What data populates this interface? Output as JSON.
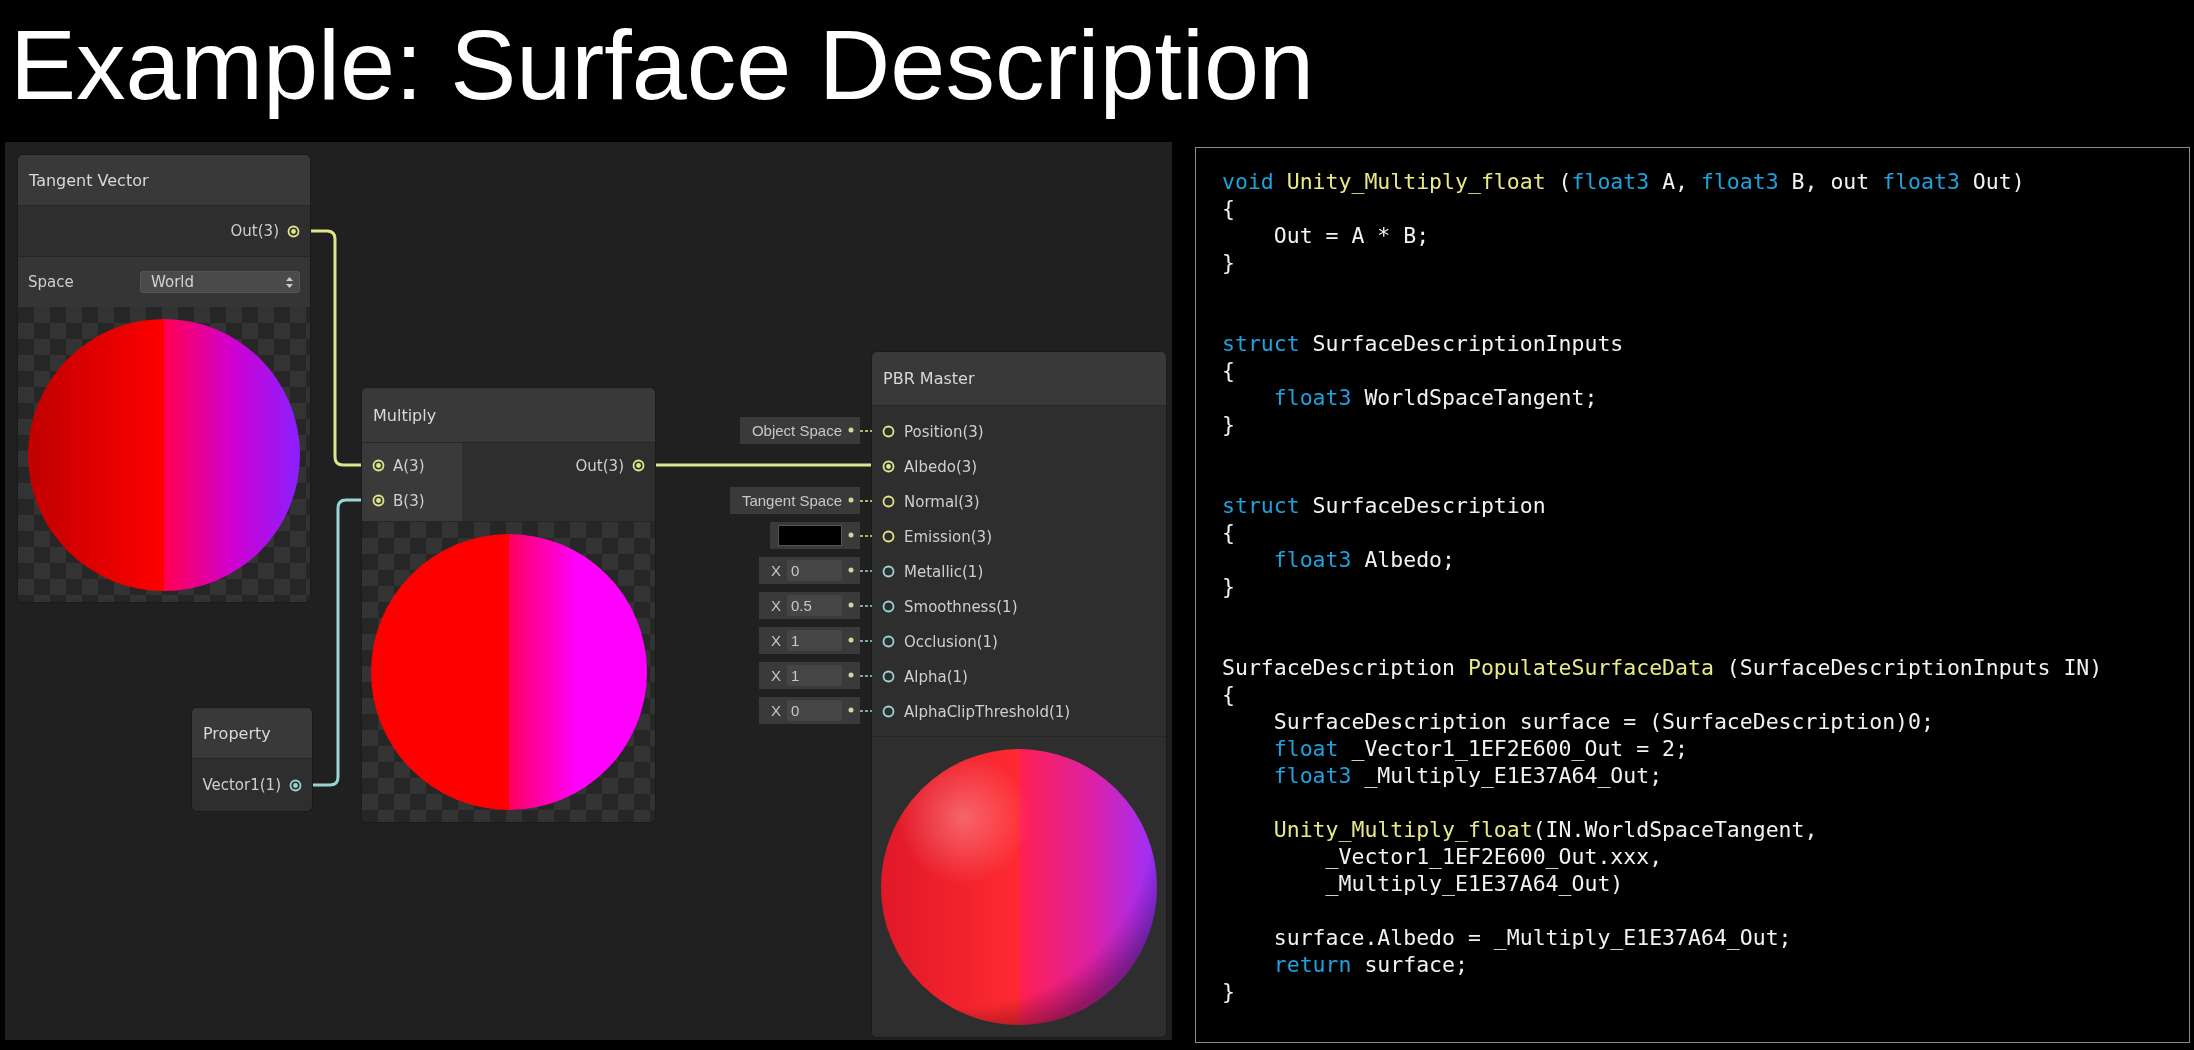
{
  "slide_title": "Example: Surface Description",
  "nodes": [
    {
      "kind": "tangent_vector",
      "title": "Tangent Vector",
      "outputs": [
        {
          "label": "Out(3)",
          "kind": "vector3",
          "connected": true
        }
      ],
      "controls": [
        {
          "label": "Space",
          "value": "World"
        }
      ]
    },
    {
      "kind": "multiply",
      "title": "Multiply",
      "inputs": [
        {
          "label": "A(3)",
          "kind": "vector3",
          "connected": true
        },
        {
          "label": "B(3)",
          "kind": "vector3",
          "connected": true
        }
      ],
      "outputs": [
        {
          "label": "Out(3)",
          "kind": "vector3",
          "connected": true
        }
      ]
    },
    {
      "kind": "property",
      "title": "Property",
      "outputs": [
        {
          "label": "Vector1(1)",
          "kind": "vector1",
          "connected": true
        }
      ]
    },
    {
      "kind": "master",
      "title": "PBR Master",
      "inputs": [
        {
          "label": "Position(3)",
          "kind": "vector3",
          "connected": false,
          "default": {
            "kind": "text",
            "text": "Object Space"
          }
        },
        {
          "label": "Albedo(3)",
          "kind": "vector3",
          "connected": true
        },
        {
          "label": "Normal(3)",
          "kind": "vector3",
          "connected": false,
          "default": {
            "kind": "text",
            "text": "Tangent Space"
          }
        },
        {
          "label": "Emission(3)",
          "kind": "vector3",
          "connected": false,
          "default": {
            "kind": "swatch",
            "color": "#000000"
          }
        },
        {
          "label": "Metallic(1)",
          "kind": "vector1",
          "connected": false,
          "default": {
            "kind": "number",
            "axis": "X",
            "value": "0"
          }
        },
        {
          "label": "Smoothness(1)",
          "kind": "vector1",
          "connected": false,
          "default": {
            "kind": "number",
            "axis": "X",
            "value": "0.5"
          }
        },
        {
          "label": "Occlusion(1)",
          "kind": "vector1",
          "connected": false,
          "default": {
            "kind": "number",
            "axis": "X",
            "value": "1"
          }
        },
        {
          "label": "Alpha(1)",
          "kind": "vector1",
          "connected": false,
          "default": {
            "kind": "number",
            "axis": "X",
            "value": "1"
          }
        },
        {
          "label": "AlphaClipThreshold(1)",
          "kind": "vector1",
          "connected": false,
          "default": {
            "kind": "number",
            "axis": "X",
            "value": "0"
          }
        }
      ]
    }
  ],
  "code": [
    {
      "kind": "section",
      "lines": [
        [
          {
            "text": "void ",
            "kind": "keyword"
          },
          {
            "text": "Unity_Multiply_float",
            "kind": "function"
          },
          {
            "text": " (",
            "kind": "plain"
          },
          {
            "text": "float3",
            "kind": "keyword"
          },
          {
            "text": " A, ",
            "kind": "plain"
          },
          {
            "text": "float3",
            "kind": "keyword"
          },
          {
            "text": " B, out ",
            "kind": "plain"
          },
          {
            "text": "float3",
            "kind": "keyword"
          },
          {
            "text": " Out)",
            "kind": "plain"
          }
        ],
        [
          {
            "text": "{",
            "kind": "plain"
          }
        ],
        [
          {
            "text": "    Out = A * B;",
            "kind": "plain"
          }
        ],
        [
          {
            "text": "}",
            "kind": "plain"
          }
        ]
      ]
    },
    {
      "kind": "section",
      "lines": [
        [
          {
            "text": "struct",
            "kind": "keyword"
          },
          {
            "text": " SurfaceDescriptionInputs",
            "kind": "plain"
          }
        ],
        [
          {
            "text": "{",
            "kind": "plain"
          }
        ],
        [
          {
            "text": "    float3",
            "kind": "keyword"
          },
          {
            "text": " WorldSpaceTangent;",
            "kind": "plain"
          }
        ],
        [
          {
            "text": "}",
            "kind": "plain"
          }
        ]
      ]
    },
    {
      "kind": "section",
      "lines": [
        [
          {
            "text": "struct",
            "kind": "keyword"
          },
          {
            "text": " SurfaceDescription",
            "kind": "plain"
          }
        ],
        [
          {
            "text": "{",
            "kind": "plain"
          }
        ],
        [
          {
            "text": "    float3",
            "kind": "keyword"
          },
          {
            "text": " Albedo;",
            "kind": "plain"
          }
        ],
        [
          {
            "text": "}",
            "kind": "plain"
          }
        ]
      ]
    },
    {
      "kind": "section",
      "lines": [
        [
          {
            "text": "SurfaceDescription ",
            "kind": "plain"
          },
          {
            "text": "PopulateSurfaceData",
            "kind": "function"
          },
          {
            "text": " (SurfaceDescriptionInputs IN)",
            "kind": "plain"
          }
        ],
        [
          {
            "text": "{",
            "kind": "plain"
          }
        ],
        [
          {
            "text": "    SurfaceDescription surface = (SurfaceDescription)0;",
            "kind": "plain"
          }
        ],
        [
          {
            "text": "    float",
            "kind": "keyword"
          },
          {
            "text": " _Vector1_1EF2E600_Out = 2;",
            "kind": "plain"
          }
        ],
        [
          {
            "text": "    float3",
            "kind": "keyword"
          },
          {
            "text": " _Multiply_E1E37A64_Out;",
            "kind": "plain"
          }
        ]
      ]
    },
    {
      "kind": "paragraph",
      "lines": [
        [
          {
            "text": "    Unity_Multiply_float",
            "kind": "function"
          },
          {
            "text": "(IN.WorldSpaceTangent,",
            "kind": "plain"
          }
        ],
        [
          {
            "text": "        _Vector1_1EF2E600_Out.xxx,",
            "kind": "plain"
          }
        ],
        [
          {
            "text": "        _Multiply_E1E37A64_Out)",
            "kind": "plain"
          }
        ]
      ]
    },
    {
      "kind": "paragraph",
      "lines": [
        [
          {
            "text": "    surface.Albedo = _Multiply_E1E37A64_Out;",
            "kind": "plain"
          }
        ],
        [
          {
            "text": "    return",
            "kind": "keyword"
          },
          {
            "text": " surface;",
            "kind": "plain"
          }
        ],
        [
          {
            "text": "}",
            "kind": "plain"
          }
        ]
      ]
    }
  ]
}
